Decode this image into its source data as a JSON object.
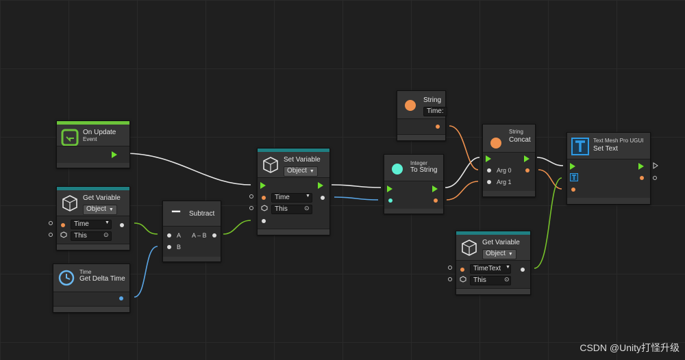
{
  "colors": {
    "flow": "#6fe02e",
    "number": "#f0924f",
    "float": "#5aa6e6",
    "object": "#6fbf2a",
    "header_event": "#6cc43a",
    "header_variable": "#1f7f82",
    "wire_flow": "#e8e8e8"
  },
  "nodes": {
    "on_update": {
      "title": "On Update",
      "subtitle": "Event",
      "icon": "update-event-icon"
    },
    "get_variable_1": {
      "title": "Get Variable",
      "kind": "Object",
      "name": "Time",
      "target": "This",
      "icon": "variable-cube-icon"
    },
    "get_delta_time": {
      "title": "Get Delta Time",
      "subtitle": "Time",
      "icon": "clock-icon"
    },
    "subtract": {
      "title": "Subtract",
      "port_a": "A",
      "port_b": "B",
      "out": "A – B",
      "icon": "minus-icon"
    },
    "set_variable": {
      "title": "Set Variable",
      "kind": "Object",
      "name": "Time",
      "target": "This",
      "icon": "variable-cube-icon"
    },
    "string_literal": {
      "title": "String",
      "value": "Time:",
      "icon": "string-dot-icon"
    },
    "to_string": {
      "subtitle": "Integer",
      "title": "To String",
      "icon": "integer-dot-icon"
    },
    "string_concat": {
      "subtitle": "String",
      "title": "Concat",
      "arg0": "Arg 0",
      "arg1": "Arg 1",
      "icon": "string-dot-icon"
    },
    "set_text": {
      "subtitle": "Text Mesh Pro UGUI",
      "title": "Set Text",
      "icon": "textmeshpro-icon"
    },
    "get_variable_2": {
      "title": "Get Variable",
      "kind": "Object",
      "name": "TimeText",
      "target": "This",
      "icon": "variable-cube-icon"
    }
  },
  "watermark": "CSDN @Unity打怪升级"
}
